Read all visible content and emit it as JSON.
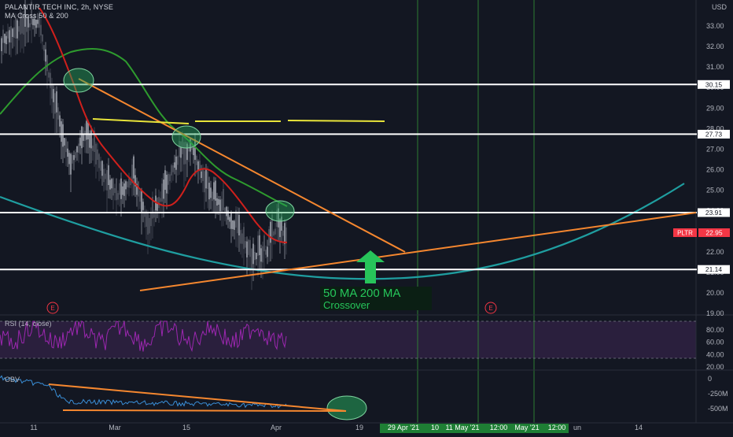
{
  "header": {
    "symbol": "PALANTIR TECH INC, 2h, NYSE",
    "indicator": "MA Cross 50 & 200",
    "currency": "USD",
    "rsi_label": "RSI (14, close)",
    "obv_label": "OBV"
  },
  "annotation": {
    "line1": "50 MA 200 MA",
    "line2": "Crossover"
  },
  "price_axis": {
    "ticks": [
      "33.00",
      "32.00",
      "31.00",
      "30.00",
      "29.00",
      "28.00",
      "27.00",
      "26.00",
      "25.00",
      "24.00",
      "23.00",
      "22.00",
      "21.00",
      "20.00",
      "19.00"
    ],
    "tick_values": [
      33,
      32,
      31,
      30,
      29,
      28,
      27,
      26,
      25,
      24,
      23,
      22,
      21,
      20,
      19
    ]
  },
  "levels": [
    {
      "label": "30.15",
      "value": 30.15
    },
    {
      "label": "27.73",
      "value": 27.73
    },
    {
      "label": "23.91",
      "value": 23.91
    },
    {
      "label": "21.14",
      "value": 21.14
    }
  ],
  "last_price": {
    "ticker": "PLTR",
    "value": "22.95",
    "color": "#f23645"
  },
  "rsi_axis": {
    "ticks": [
      "80.00",
      "60.00",
      "40.00",
      "20.00"
    ],
    "tick_values": [
      80,
      60,
      40,
      20
    ]
  },
  "obv_axis": {
    "ticks": [
      "0",
      "-250M",
      "-500M"
    ]
  },
  "time_axis": {
    "labels": [
      "11",
      "Mar",
      "15",
      "Apr",
      "19",
      "14"
    ],
    "highlighted": [
      "29 Apr '21",
      "10",
      "11 May '21",
      "12:00",
      "May '21",
      "12:00",
      "un"
    ]
  },
  "earnings_marker": "E",
  "colors": {
    "background": "#131722",
    "ma50": "#d0201c",
    "ma200": "#2e9b2e",
    "arc": "#1f9ea0",
    "trend": "#f5872f",
    "yellow": "#e8e43a",
    "level": "#ffffff",
    "rsi_line": "#9c27b0",
    "rsi_band": "#2a1f3d",
    "obv_line": "#3a8fd8",
    "circle": "#26a65b",
    "vline": "#2e7d32",
    "arrow": "#27c45a"
  },
  "chart_data": {
    "type": "line",
    "title": "PALANTIR TECH INC, 2h, NYSE",
    "ylim": [
      18.6,
      34.1
    ],
    "series": [
      {
        "name": "MA Cross 50 & 200"
      }
    ],
    "horizontal_levels": [
      30.15,
      27.73,
      23.91,
      21.14
    ],
    "last_price": 22.95
  }
}
